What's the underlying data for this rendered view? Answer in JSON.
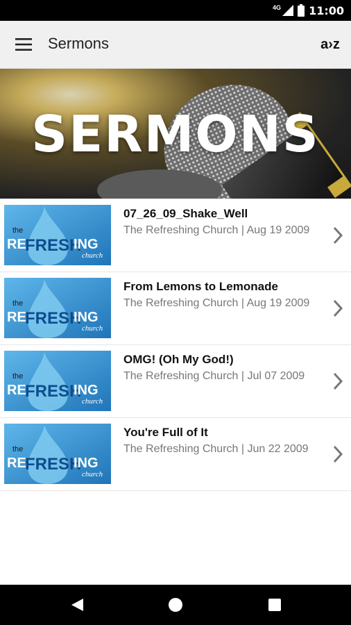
{
  "status_bar": {
    "time": "11:00",
    "network_label": "4G"
  },
  "app_bar": {
    "title": "Sermons",
    "sort_label": "a›z"
  },
  "hero": {
    "title": "SERMONS"
  },
  "thumbnail": {
    "the": "the",
    "brand_re": "RE",
    "brand_fresh": "FRESH",
    "brand_ing": "ING",
    "brand_church": "church"
  },
  "sermons": [
    {
      "title": "07_26_09_Shake_Well",
      "subtitle": "The Refreshing Church | Aug 19 2009"
    },
    {
      "title": "From Lemons to Lemonade",
      "subtitle": "The Refreshing Church | Aug 19 2009"
    },
    {
      "title": "OMG! (Oh My God!)",
      "subtitle": "The Refreshing Church | Jul 07 2009"
    },
    {
      "title": "You're Full of It",
      "subtitle": "The Refreshing Church | Jun 22 2009"
    }
  ],
  "colors": {
    "app_bar_bg": "#f0f0f0",
    "thumb_blue": "#2f8fd0",
    "subtitle_gray": "#777777"
  }
}
